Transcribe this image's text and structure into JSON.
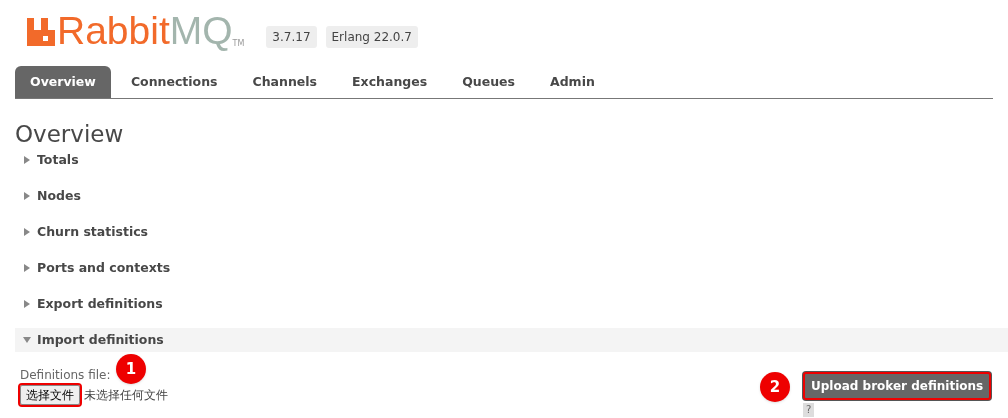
{
  "logo": {
    "part_1": "Rabbit",
    "part_2": "MQ",
    "trademark": "TM"
  },
  "badges": [
    "3.7.17",
    "Erlang 22.0.7"
  ],
  "tabs": [
    {
      "label": "Overview",
      "selected": true
    },
    {
      "label": "Connections",
      "selected": false
    },
    {
      "label": "Channels",
      "selected": false
    },
    {
      "label": "Exchanges",
      "selected": false
    },
    {
      "label": "Queues",
      "selected": false
    },
    {
      "label": "Admin",
      "selected": false
    }
  ],
  "heading": "Overview",
  "sections": [
    {
      "title": "Totals",
      "expanded": false
    },
    {
      "title": "Nodes",
      "expanded": false
    },
    {
      "title": "Churn statistics",
      "expanded": false
    },
    {
      "title": "Ports and contexts",
      "expanded": false
    },
    {
      "title": "Export definitions",
      "expanded": false
    },
    {
      "title": "Import definitions",
      "expanded": true
    }
  ],
  "import": {
    "label": "Definitions file:",
    "file_button": "选择文件",
    "file_status": "未选择任何文件",
    "upload_button": "Upload broker definitions",
    "help": "?"
  },
  "markers": [
    "1",
    "2"
  ]
}
